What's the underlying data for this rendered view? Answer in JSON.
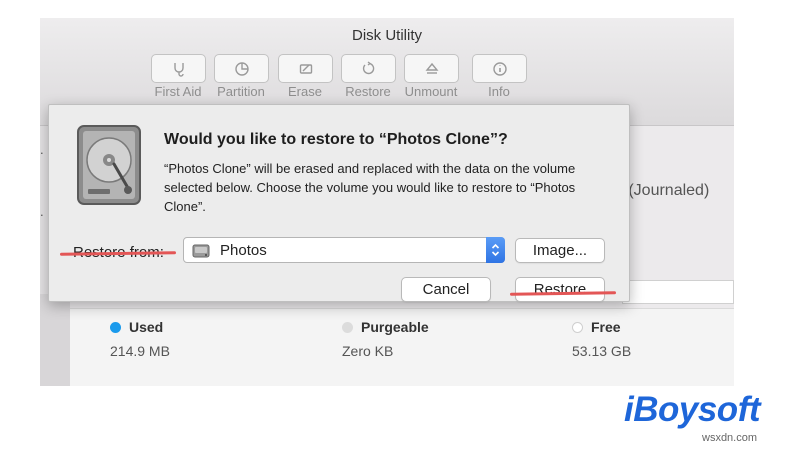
{
  "app": {
    "title": "Disk Utility"
  },
  "toolbar": [
    {
      "label": "First Aid",
      "icon": "stethoscope-icon"
    },
    {
      "label": "Partition",
      "icon": "pie-chart-icon"
    },
    {
      "label": "Erase",
      "icon": "erase-icon"
    },
    {
      "label": "Restore",
      "icon": "restore-arrow-icon"
    },
    {
      "label": "Unmount",
      "icon": "eject-icon"
    },
    {
      "label": "Info",
      "icon": "info-icon"
    }
  ],
  "background": {
    "format_text": "d (Journaled)"
  },
  "stats": [
    {
      "label": "Used",
      "value": "214.9 MB",
      "color": "#1a9aec"
    },
    {
      "label": "Purgeable",
      "value": "Zero KB",
      "color": "#dcdcdc"
    },
    {
      "label": "Free",
      "value": "53.13 GB",
      "color": "#ffffff"
    }
  ],
  "dialog": {
    "title": "Would you like to restore to “Photos Clone”?",
    "body": "“Photos Clone” will be erased and replaced with the data on the volume selected below. Choose the volume you would like to restore to “Photos Clone”.",
    "restore_from_label": "Restore from:",
    "selected_volume": "Photos",
    "image_button": "Image...",
    "cancel_button": "Cancel",
    "restore_button": "Restore"
  },
  "highlight_color": "#e35656",
  "brand": {
    "name": "iBoysoft",
    "watermark": "wsxdn.com"
  }
}
